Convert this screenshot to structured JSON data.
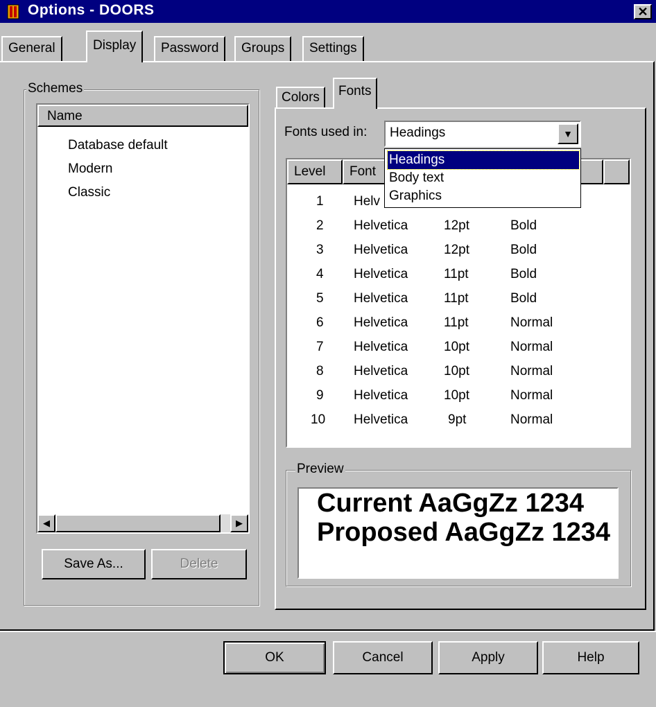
{
  "window": {
    "title": "Options - DOORS",
    "close_label": "✕"
  },
  "tabs": [
    {
      "label": "General"
    },
    {
      "label": "Display"
    },
    {
      "label": "Password"
    },
    {
      "label": "Groups"
    },
    {
      "label": "Settings"
    }
  ],
  "schemes": {
    "group_label": "Schemes",
    "column_header": "Name",
    "items": [
      "Database default",
      "Modern",
      "Classic"
    ],
    "save_as_label": "Save As...",
    "delete_label": "Delete"
  },
  "subtabs": [
    {
      "label": "Colors"
    },
    {
      "label": "Fonts"
    }
  ],
  "fonts": {
    "used_in_label": "Fonts used in:",
    "combo_value": "Headings",
    "dropdown_options": [
      "Headings",
      "Body text",
      "Graphics"
    ],
    "columns": [
      "Level",
      "Font"
    ],
    "rows": [
      {
        "level": "1",
        "font": "Helv",
        "size": "",
        "style": ""
      },
      {
        "level": "2",
        "font": "Helvetica",
        "size": "12pt",
        "style": "Bold"
      },
      {
        "level": "3",
        "font": "Helvetica",
        "size": "12pt",
        "style": "Bold"
      },
      {
        "level": "4",
        "font": "Helvetica",
        "size": "11pt",
        "style": "Bold"
      },
      {
        "level": "5",
        "font": "Helvetica",
        "size": "11pt",
        "style": "Bold"
      },
      {
        "level": "6",
        "font": "Helvetica",
        "size": "11pt",
        "style": "Normal"
      },
      {
        "level": "7",
        "font": "Helvetica",
        "size": "10pt",
        "style": "Normal"
      },
      {
        "level": "8",
        "font": "Helvetica",
        "size": "10pt",
        "style": "Normal"
      },
      {
        "level": "9",
        "font": "Helvetica",
        "size": "10pt",
        "style": "Normal"
      },
      {
        "level": "10",
        "font": "Helvetica",
        "size": "9pt",
        "style": "Normal"
      }
    ]
  },
  "preview": {
    "group_label": "Preview",
    "current_text": "Current AaGgZz 1234",
    "proposed_text": "Proposed AaGgZz 1234"
  },
  "buttons": {
    "ok": "OK",
    "cancel": "Cancel",
    "apply": "Apply",
    "help": "Help"
  },
  "colors": {
    "titlebar": "#000080",
    "face": "#c0c0c0",
    "selection": "#000080"
  }
}
